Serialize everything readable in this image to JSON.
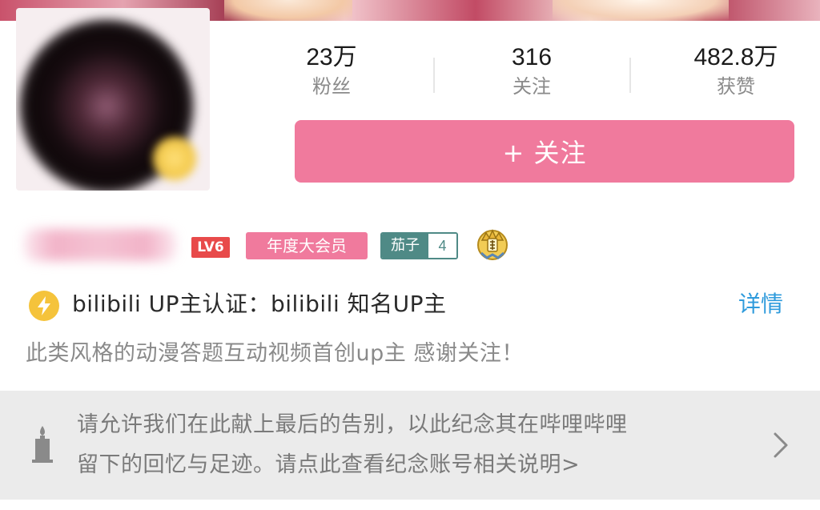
{
  "profile": {
    "stats": [
      {
        "value": "23万",
        "label": "粉丝"
      },
      {
        "value": "316",
        "label": "关注"
      },
      {
        "value": "482.8万",
        "label": "获赞"
      }
    ],
    "follow_button": "+ 关注",
    "level_badge": "LV6",
    "vip_badge": "年度大会员",
    "medal": {
      "name": "茄子",
      "level": "4"
    },
    "certification": "bilibili  UP主认证：bilibili  知名UP主",
    "detail_link": "详情",
    "signature": "此类风格的动漫答题互动视频首创up主  感谢关注！"
  },
  "memorial": {
    "line1": "请允许我们在此献上最后的告别，以此纪念其在哔哩哔哩",
    "line2": "留下的回忆与足迹。请点此查看纪念账号相关说明>"
  },
  "colors": {
    "accent_pink": "#f07a9d",
    "level_red": "#e84a4a",
    "medal_teal": "#4f8a86",
    "link_blue": "#2f9bdc",
    "cert_gold": "#f5c33b",
    "memorial_bg": "#ebebeb"
  },
  "icons": {
    "cert": "lightning-icon",
    "crown": "crown-icon",
    "candle": "candle-icon",
    "chevron": "chevron-right-icon"
  }
}
